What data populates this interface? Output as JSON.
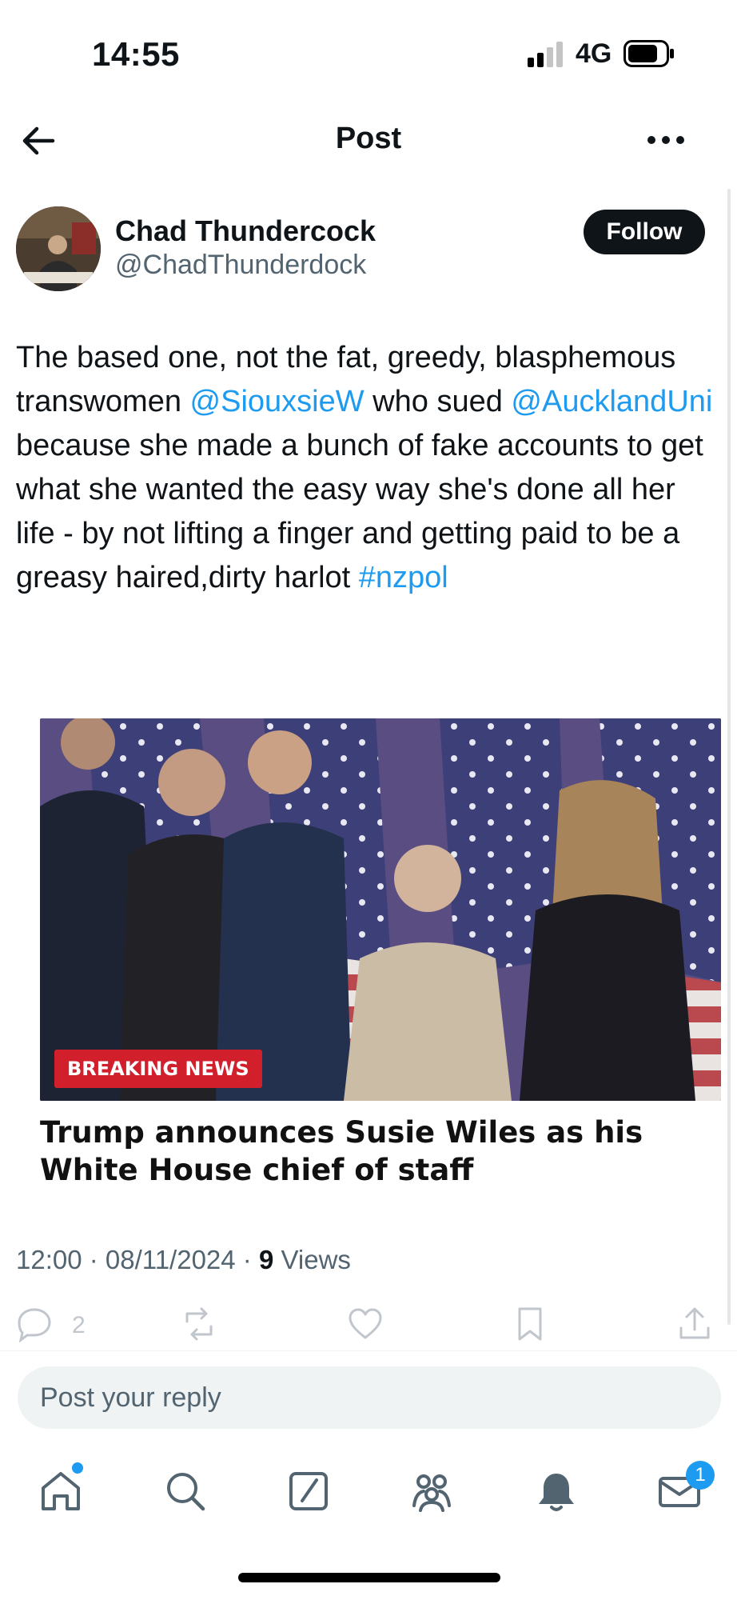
{
  "status_bar": {
    "time": "14:55",
    "network": "4G"
  },
  "header": {
    "title": "Post",
    "back_icon": "arrow-left-icon",
    "more_icon": "more-horizontal-icon"
  },
  "author": {
    "name": "Chad Thundercock",
    "handle": "@ChadThunderdock",
    "follow_label": "Follow"
  },
  "tweet": {
    "segments": [
      {
        "text": "The based one, not the fat, greedy, blasphemous transwomen ",
        "link": false
      },
      {
        "text": "@SiouxsieW",
        "link": true
      },
      {
        "text": " who sued ",
        "link": false
      },
      {
        "text": "@AucklandUni",
        "link": true
      },
      {
        "text": " because she made a bunch of fake accounts to get what she wanted the easy way she's done all her life - by not lifting a finger and getting paid to be a greasy haired,dirty harlot ",
        "link": false
      },
      {
        "text": "#nzpol",
        "link": true
      }
    ]
  },
  "card": {
    "badge": "BREAKING NEWS",
    "headline": "Trump announces Susie Wiles as his White House chief of staff"
  },
  "meta": {
    "time": "12:00",
    "date": "08/11/2024",
    "views_count": "9",
    "views_label": "Views"
  },
  "actions": {
    "reply_count": "2"
  },
  "reply_box": {
    "placeholder": "Post your reply"
  },
  "nav": {
    "notification_count": "1"
  },
  "colors": {
    "accent": "#1d9bf0",
    "text": "#0f1419",
    "secondary": "#536471",
    "badge_red": "#d11f2c"
  }
}
